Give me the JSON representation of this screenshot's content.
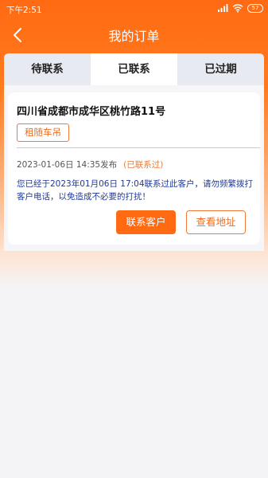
{
  "status_bar": {
    "time": "下午2:51",
    "battery": "57"
  },
  "header": {
    "title": "我的订单"
  },
  "tabs": [
    {
      "label": "待联系",
      "active": false
    },
    {
      "label": "已联系",
      "active": true
    },
    {
      "label": "已过期",
      "active": false
    }
  ],
  "order": {
    "address": "四川省成都市成华区桃竹路11号",
    "tag": "租随车吊",
    "published": "2023-01-06日 14:35发布",
    "status": "(已联系过)",
    "notice": "您已经于2023年01月06日 17:04联系过此客户，请勿频繁拨打客户电话，以免造成不必要的打扰！",
    "contact_button": "联系客户",
    "address_button": "查看地址"
  },
  "colors": {
    "accent": "#ff6a12",
    "notice_text": "#1f3a9a"
  }
}
